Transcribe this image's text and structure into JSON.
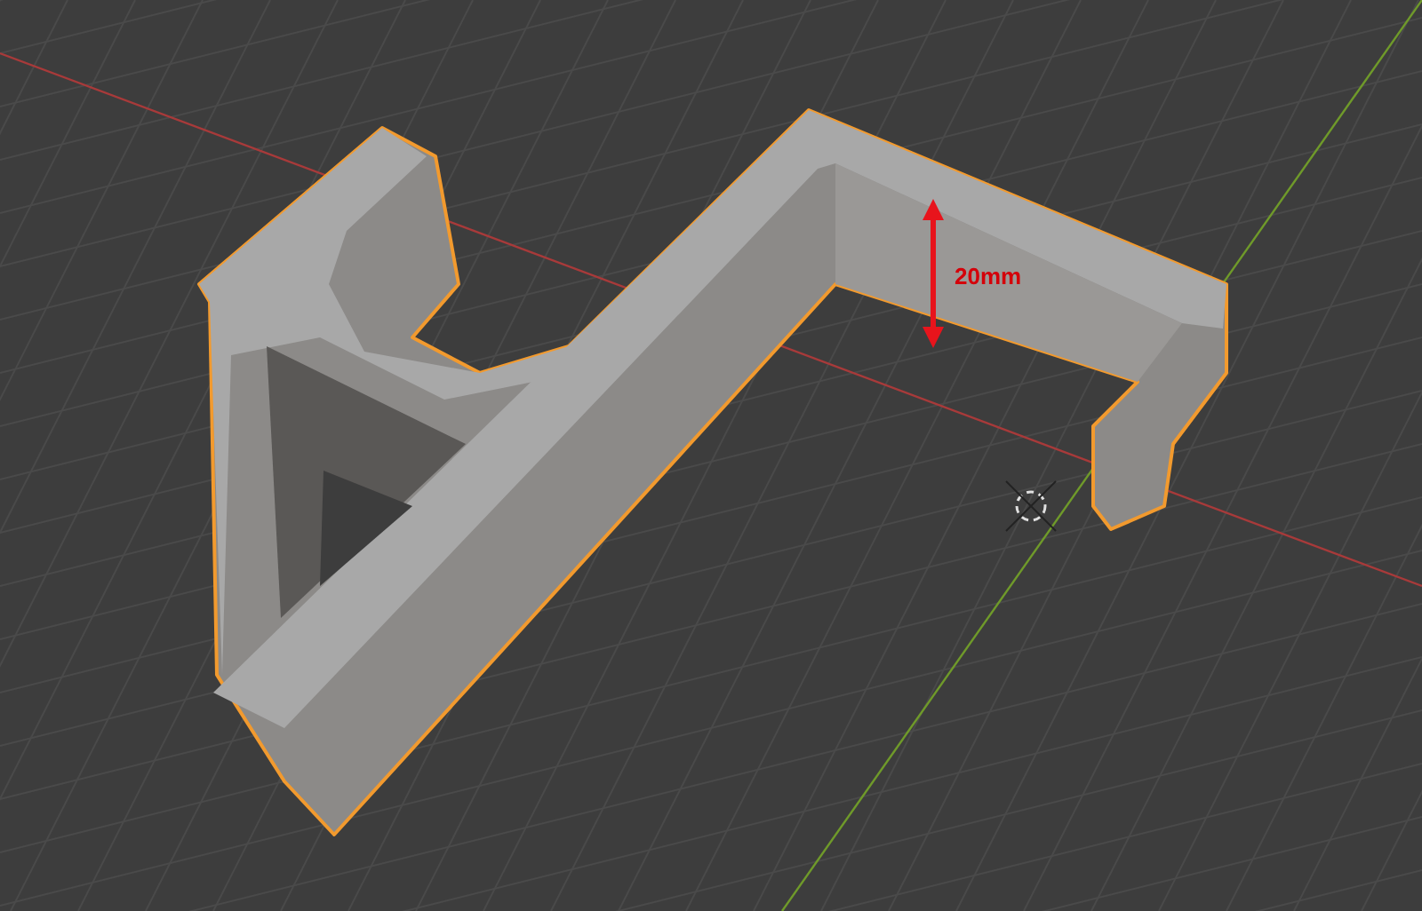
{
  "viewport": {
    "dimension": {
      "label": "20mm"
    }
  }
}
